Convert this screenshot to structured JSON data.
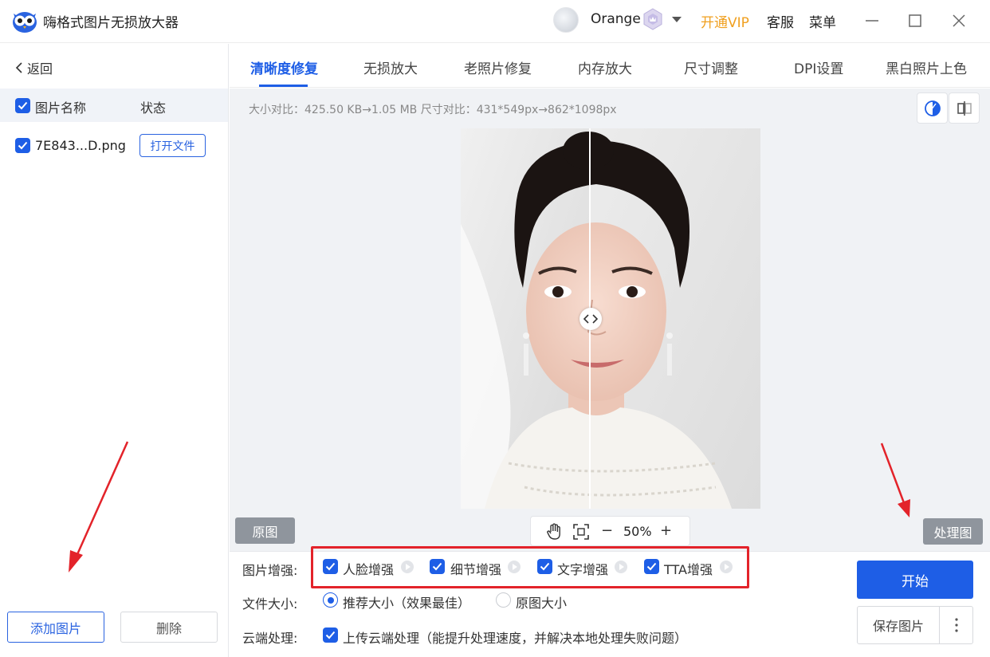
{
  "app": {
    "title": "嗨格式图片无损放大器"
  },
  "header": {
    "user_name": "Orange",
    "vip_label": "开通VIP",
    "service_label": "客服",
    "menu_label": "菜单"
  },
  "sidebar": {
    "back_label": "返回",
    "columns": {
      "name": "图片名称",
      "status": "状态"
    },
    "files": [
      {
        "name": "7E843...D.png",
        "action": "打开文件"
      }
    ],
    "add_label": "添加图片",
    "delete_label": "删除"
  },
  "tabs": [
    "清晰度修复",
    "无损放大",
    "老照片修复",
    "内存放大",
    "尺寸调整",
    "DPI设置",
    "黑白照片上色"
  ],
  "preview": {
    "compare_info": "大小对比：425.50 KB→1.05 MB   尺寸对比：431*549px→862*1098px",
    "original_tag": "原图",
    "processed_tag": "处理图",
    "zoom_level": "50%",
    "zoom_minus": "−",
    "zoom_plus": "+"
  },
  "settings": {
    "enhance_label": "图片增强:",
    "enhance_options": [
      "人脸增强",
      "细节增强",
      "文字增强",
      "TTA增强"
    ],
    "size_label": "文件大小:",
    "size_options": [
      "推荐大小（效果最佳）",
      "原图大小"
    ],
    "cloud_label": "云端处理:",
    "cloud_option": "上传云端处理（能提升处理速度，并解决本地处理失败问题）"
  },
  "actions": {
    "start_label": "开始",
    "save_label": "保存图片"
  },
  "colors": {
    "accent": "#1e5ee6",
    "vip": "#f0a020",
    "highlight": "#e3232a"
  }
}
